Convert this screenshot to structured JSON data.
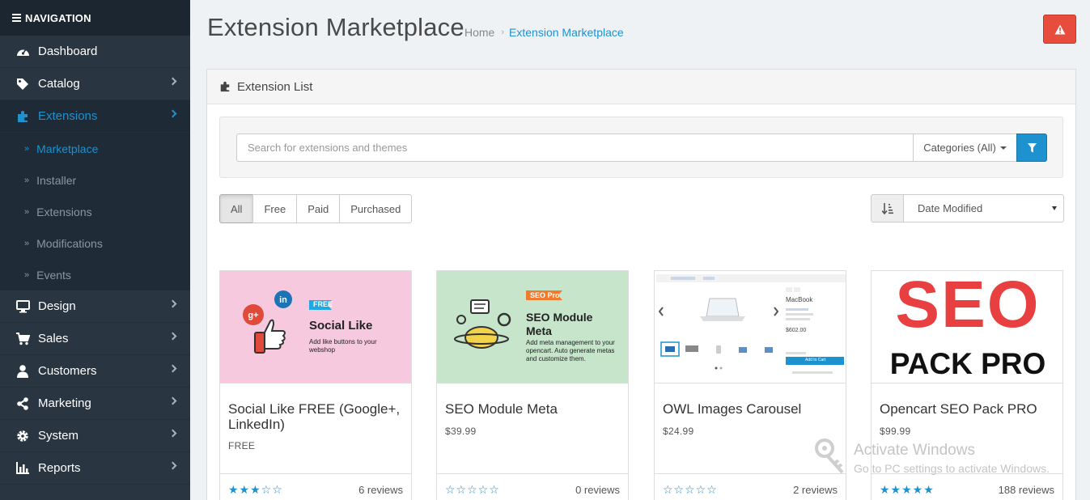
{
  "sidebar": {
    "heading": "NAVIGATION",
    "items": [
      {
        "label": "Dashboard",
        "icon": "dashboard-icon"
      },
      {
        "label": "Catalog",
        "icon": "tag-icon"
      },
      {
        "label": "Extensions",
        "icon": "puzzle-icon"
      },
      {
        "label": "Design",
        "icon": "desktop-icon"
      },
      {
        "label": "Sales",
        "icon": "cart-icon"
      },
      {
        "label": "Customers",
        "icon": "user-icon"
      },
      {
        "label": "Marketing",
        "icon": "share-icon"
      },
      {
        "label": "System",
        "icon": "gear-icon"
      },
      {
        "label": "Reports",
        "icon": "bar-chart-icon"
      }
    ],
    "sub_items": [
      "Marketplace",
      "Installer",
      "Extensions",
      "Modifications",
      "Events"
    ]
  },
  "header": {
    "title": "Extension Marketplace",
    "breadcrumb": [
      "Home",
      "Extension Marketplace"
    ]
  },
  "panel": {
    "title": "Extension List",
    "search_placeholder": "Search for extensions and themes",
    "categories_label": "Categories (All)",
    "filters": [
      "All",
      "Free",
      "Paid",
      "Purchased"
    ],
    "active_filter": "All",
    "sort_value": "Date Modified"
  },
  "products": [
    {
      "name": "Social Like FREE (Google+, LinkedIn)",
      "price": "FREE",
      "rating": 3,
      "reviews": "6 reviews",
      "thumb": {
        "badge": "FREE",
        "title": "Social Like",
        "desc": "Add like buttons to your webshop",
        "bg": "#f7c9de"
      }
    },
    {
      "name": "SEO Module Meta",
      "price": "$39.99",
      "rating": 0,
      "reviews": "0 reviews",
      "thumb": {
        "badge": "SEO Pro",
        "title": "SEO Module Meta",
        "desc": "Add meta management to your opencart. Auto generate metas and customize them.",
        "bg": "#c6e5cb"
      }
    },
    {
      "name": "OWL Images Carousel",
      "price": "$24.99",
      "rating": 0,
      "reviews": "2 reviews",
      "thumb": {
        "product": "MacBook",
        "price": "$602.00",
        "button": "Add to Cart",
        "bg": "#ffffff"
      }
    },
    {
      "name": "Opencart SEO Pack PRO",
      "price": "$99.99",
      "rating": 5,
      "reviews": "188 reviews",
      "thumb": {
        "line1": "SEO",
        "line2": "PACK PRO",
        "bg": "#ffffff"
      }
    }
  ],
  "watermark": {
    "title": "Activate Windows",
    "subtitle": "Go to PC settings to activate Windows."
  },
  "colors": {
    "sidebar_bg": "#2a3542",
    "accent": "#1e91cf",
    "danger": "#e74c3c"
  }
}
